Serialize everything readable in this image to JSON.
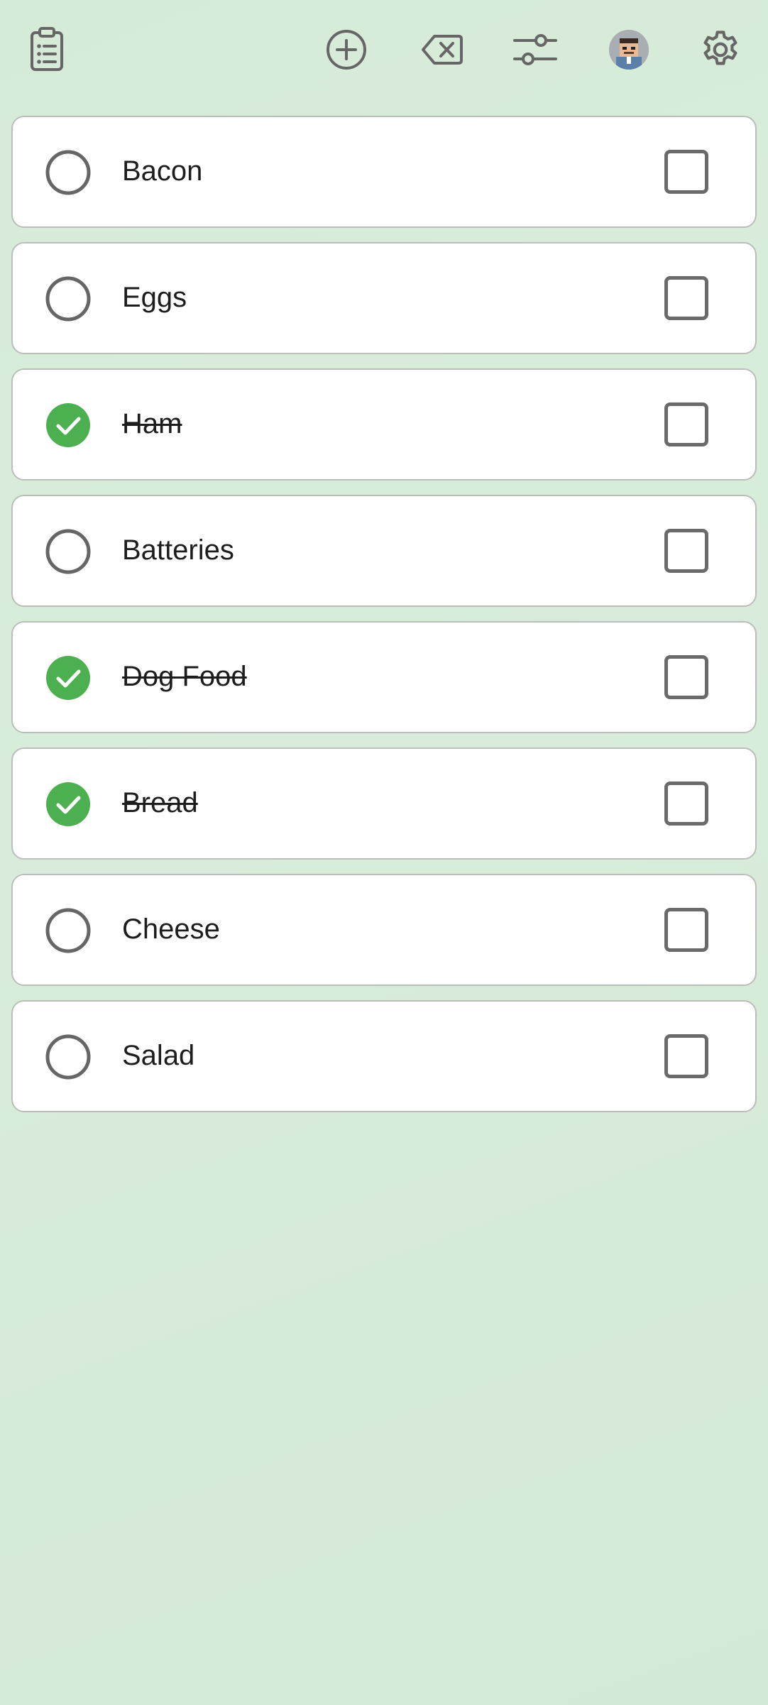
{
  "toolbar": {
    "icons": [
      "clipboard-list-icon",
      "add-circle-icon",
      "backspace-icon",
      "sliders-icon",
      "avatar",
      "gear-icon"
    ]
  },
  "colors": {
    "background": "#d7ebd8",
    "check_green": "#4caf50",
    "icon_gray": "#666666"
  },
  "items": [
    {
      "label": "Bacon",
      "done": false
    },
    {
      "label": "Eggs",
      "done": false
    },
    {
      "label": "Ham",
      "done": true
    },
    {
      "label": "Batteries",
      "done": false
    },
    {
      "label": "Dog Food",
      "done": true
    },
    {
      "label": "Bread",
      "done": true
    },
    {
      "label": "Cheese",
      "done": false
    },
    {
      "label": "Salad",
      "done": false
    }
  ]
}
